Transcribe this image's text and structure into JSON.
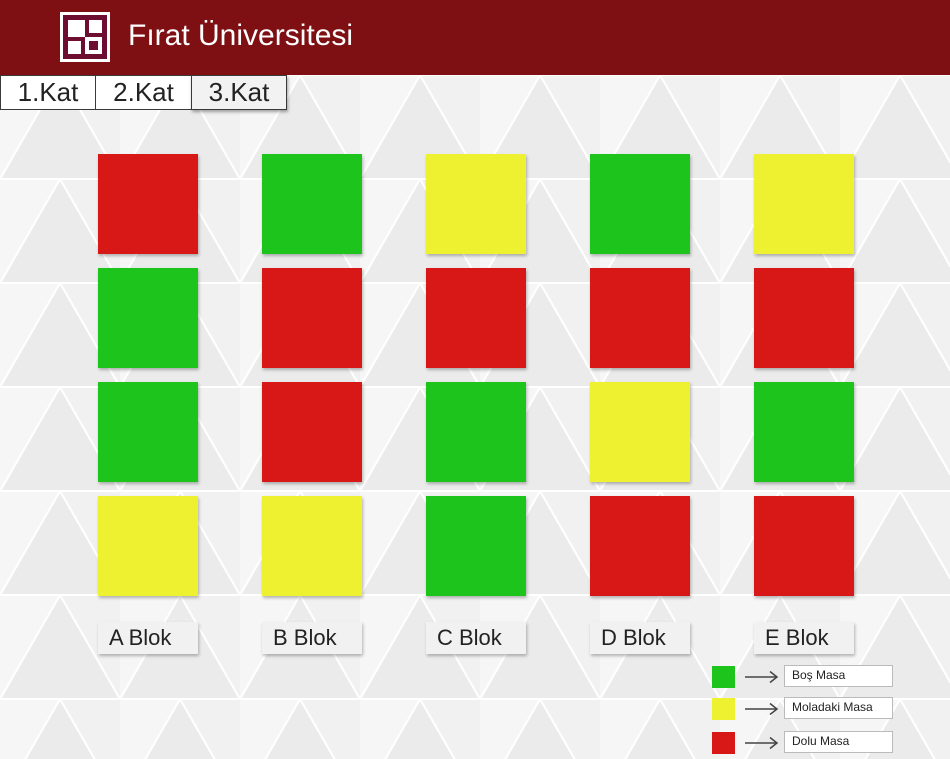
{
  "colors": {
    "header_bg": "#7e1013",
    "empty": "#1cc41c",
    "break": "#eef12f",
    "full": "#d81717"
  },
  "header": {
    "logo_icon": "university-logo-icon",
    "title": "Fırat Üniversitesi"
  },
  "floor_tabs": [
    {
      "label": "1.Kat",
      "active": false
    },
    {
      "label": "2.Kat",
      "active": false
    },
    {
      "label": "3.Kat",
      "active": true
    }
  ],
  "blocks": [
    {
      "label": "A Blok",
      "desks": [
        "full",
        "empty",
        "empty",
        "break"
      ]
    },
    {
      "label": "B Blok",
      "desks": [
        "empty",
        "full",
        "full",
        "break"
      ]
    },
    {
      "label": "C Blok",
      "desks": [
        "break",
        "full",
        "empty",
        "empty"
      ]
    },
    {
      "label": "D Blok",
      "desks": [
        "empty",
        "full",
        "break",
        "full"
      ]
    },
    {
      "label": "E Blok",
      "desks": [
        "break",
        "full",
        "empty",
        "full"
      ]
    }
  ],
  "legend": [
    {
      "status": "empty",
      "label": "Boş Masa",
      "icon": "arrow-right-icon"
    },
    {
      "status": "break",
      "label": "Moladaki Masa",
      "icon": "arrow-right-icon"
    },
    {
      "status": "full",
      "label": "Dolu Masa",
      "icon": "arrow-right-icon"
    }
  ]
}
